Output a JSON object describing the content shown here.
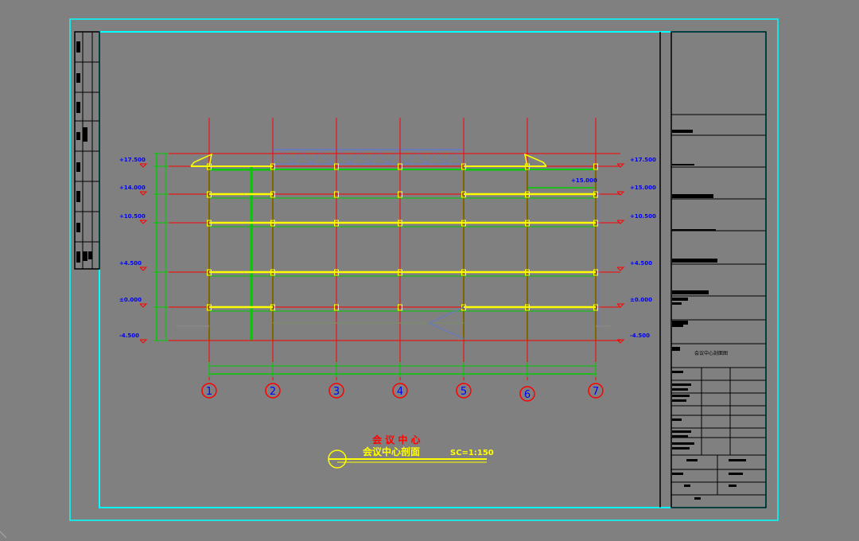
{
  "colors": {
    "background": "#808080",
    "frame": "#00ffff",
    "grid": "#ff0000",
    "structure": "#00cc00",
    "slab": "#ffff00",
    "level_text": "#0000ff",
    "truss": "#6a7ab8",
    "title_block": "#000000",
    "title_text": "#ff0000",
    "caption_text": "#ffff00"
  },
  "elevations_left": [
    "+17.500",
    "+14.000",
    "+10.500",
    "+4.500",
    "±0.000",
    "-4.500"
  ],
  "elevations_right": [
    "+17.500",
    "+15.000",
    "+10.500",
    "+4.500",
    "±0.000",
    "-4.500"
  ],
  "elevation_mid": "+15.000",
  "axis_labels": [
    "1",
    "2",
    "3",
    "4",
    "5",
    "6",
    "7"
  ],
  "drawing": {
    "project_title": "会 议 中 心",
    "section_title": "会议中心剖面",
    "scale": "SC=1:150"
  },
  "title_block": {
    "drawing_name": "会议中心剖面图"
  }
}
